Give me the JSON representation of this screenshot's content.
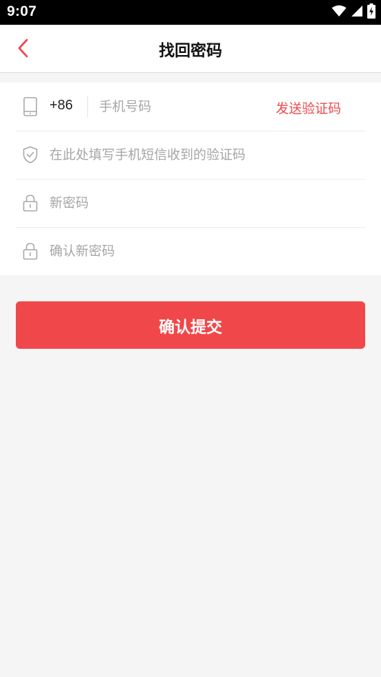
{
  "status_bar": {
    "time": "9:07",
    "icons": [
      "wifi-icon",
      "signal-icon",
      "battery-charging-icon"
    ]
  },
  "header": {
    "title": "找回密码",
    "back_icon": "chevron-left-icon"
  },
  "form": {
    "phone": {
      "icon": "phone-icon",
      "country_code": "+86",
      "placeholder": "手机号码",
      "value": "",
      "send_code_label": "发送验证码"
    },
    "verification_code": {
      "icon": "shield-check-icon",
      "placeholder": "在此处填写手机短信收到的验证码",
      "value": ""
    },
    "new_password": {
      "icon": "lock-icon",
      "placeholder": "新密码",
      "value": ""
    },
    "confirm_password": {
      "icon": "lock-icon",
      "placeholder": "确认新密码",
      "value": ""
    }
  },
  "submit": {
    "label": "确认提交"
  },
  "colors": {
    "accent": "#f0484a",
    "icon_gray": "#a6a6a6",
    "background": "#f5f5f5"
  }
}
